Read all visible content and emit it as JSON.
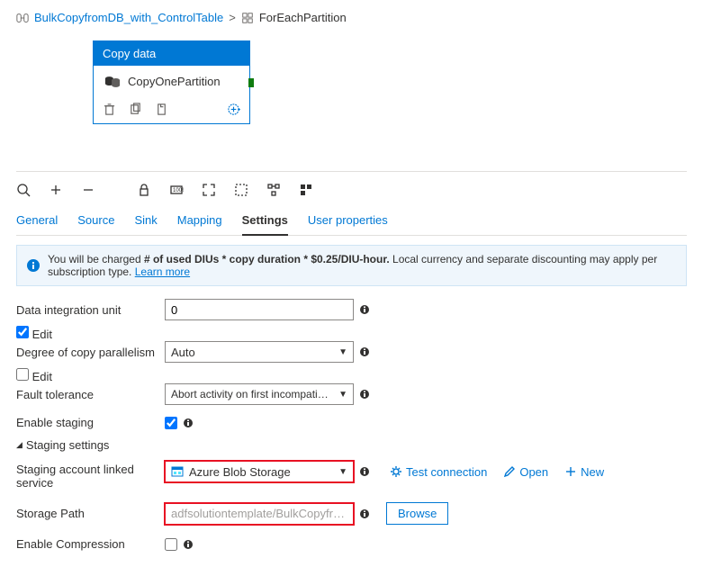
{
  "breadcrumb": {
    "parent": "BulkCopyfromDB_with_ControlTable",
    "current": "ForEachPartition"
  },
  "activity": {
    "type_label": "Copy data",
    "name": "CopyOnePartition"
  },
  "tabs": [
    "General",
    "Source",
    "Sink",
    "Mapping",
    "Settings",
    "User properties"
  ],
  "active_tab": "Settings",
  "infobar": {
    "prefix": "You will be charged ",
    "formula": "# of used DIUs * copy duration * $0.25/DIU-hour.",
    "suffix": " Local currency and separate discounting may apply per subscription type. ",
    "link": "Learn more"
  },
  "form": {
    "diu": {
      "label": "Data integration unit",
      "value": "0",
      "edit": "Edit",
      "edit_checked": true
    },
    "parallelism": {
      "label": "Degree of copy parallelism",
      "value": "Auto",
      "edit": "Edit",
      "edit_checked": false
    },
    "fault": {
      "label": "Fault tolerance",
      "value": "Abort activity on first incompatible row"
    },
    "staging": {
      "label": "Enable staging",
      "checked": true
    },
    "staging_header": "Staging settings",
    "linked": {
      "label": "Staging account linked service",
      "value": "Azure Blob Storage"
    },
    "actions": {
      "test": "Test connection",
      "open": "Open",
      "new": "New"
    },
    "path": {
      "label": "Storage Path",
      "value": "adfsolutiontemplate/BulkCopyfromDB_with_ControlTable",
      "browse": "Browse"
    },
    "compression": {
      "label": "Enable Compression",
      "checked": false
    }
  }
}
